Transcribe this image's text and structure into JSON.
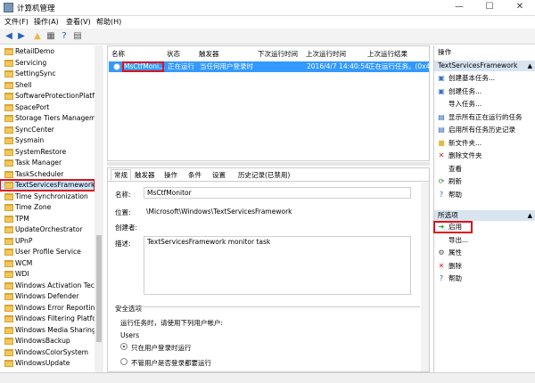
{
  "window": {
    "title": "计算机管理"
  },
  "menu": [
    "文件(F)",
    "操作(A)",
    "查看(V)",
    "帮助(H)"
  ],
  "tree": {
    "items": [
      "RetailDemo",
      "Servicing",
      "SettingSync",
      "Shell",
      "SoftwareProtectionPlatfo",
      "SpacePort",
      "Storage Tiers Managem",
      "SyncCenter",
      "Sysmain",
      "SystemRestore",
      "Task Manager",
      "TaskScheduler",
      "TextServicesFramework",
      "Time Synchronization",
      "Time Zone",
      "TPM",
      "UpdateOrchestrator",
      "UPnP",
      "User Profile Service",
      "WCM",
      "WDI",
      "Windows Activation Tech",
      "Windows Defender",
      "Windows Error Reportin",
      "Windows Filtering Platfo",
      "Windows Media Sharing",
      "WindowsBackup",
      "WindowsColorSystem",
      "WindowsUpdate"
    ],
    "selected": "TextServicesFramework"
  },
  "task_list": {
    "columns": [
      "名称",
      "状态",
      "触发器",
      "下次运行时间",
      "上次运行时间",
      "上次运行结果"
    ],
    "rows": [
      {
        "name": "MsCtfMoni...",
        "status": "正在运行",
        "trigger": "当任何用户登录时",
        "next_run": "",
        "last_run": "2016/4/7 14:40:54",
        "last_result": "正在运行任务。(0x4"
      }
    ]
  },
  "detail": {
    "tabs": [
      "常规",
      "触发器",
      "操作",
      "条件",
      "设置",
      "历史记录(已禁用)"
    ],
    "labels": {
      "name": "名称:",
      "location": "位置:",
      "author": "创建者:",
      "description": "描述:"
    },
    "name": "MsCtfMonitor",
    "location": "\\Microsoft\\Windows\\TextServicesFramework",
    "author": "",
    "description": "TextServicesFramework monitor task",
    "security_title": "安全选项",
    "run_as_label": "运行任务时，请使用下列用户帐户:",
    "run_as_user": "Users",
    "radio1": "只在用户登录时运行",
    "radio2": "不管用户是否登录都要运行"
  },
  "actions": {
    "header": "操作",
    "section1_title": "TextServicesFramework",
    "section1": [
      {
        "icon": "create-basic-task-icon",
        "glyph": "▣",
        "color": "#3b74c4",
        "label": "创建基本任务..."
      },
      {
        "icon": "create-task-icon",
        "glyph": "▣",
        "color": "#3b74c4",
        "label": "创建任务..."
      },
      {
        "icon": "",
        "glyph": "",
        "color": "#000",
        "label": "导入任务..."
      },
      {
        "icon": "show-running-icon",
        "glyph": "▤",
        "color": "#2a63b4",
        "label": "显示所有正在运行的任务"
      },
      {
        "icon": "enable-history-icon",
        "glyph": "▤",
        "color": "#2a63b4",
        "label": "启用所有任务历史记录"
      },
      {
        "icon": "new-folder-icon",
        "glyph": "■",
        "color": "#e8b84a",
        "label": "新文件夹..."
      },
      {
        "icon": "delete-folder-icon",
        "glyph": "✕",
        "color": "#d32020",
        "label": "删除文件夹"
      },
      {
        "icon": "",
        "glyph": "",
        "color": "#000",
        "label": "查看"
      },
      {
        "icon": "refresh-icon",
        "glyph": "⟳",
        "color": "#2c8a2c",
        "label": "刷新"
      },
      {
        "icon": "help-icon",
        "glyph": "?",
        "color": "#2a63b4",
        "label": "帮助"
      }
    ],
    "section2_title": "所选项",
    "section2": [
      {
        "icon": "run-icon",
        "glyph": "➜",
        "color": "#1f9d2a",
        "label": "启用"
      },
      {
        "icon": "",
        "glyph": "",
        "color": "#000",
        "label": "导出..."
      },
      {
        "icon": "properties-icon",
        "glyph": "⚙",
        "color": "#555",
        "label": "属性"
      },
      {
        "icon": "delete-icon",
        "glyph": "✕",
        "color": "#d32020",
        "label": "删除"
      },
      {
        "icon": "help-icon",
        "glyph": "?",
        "color": "#2a63b4",
        "label": "帮助"
      }
    ]
  }
}
